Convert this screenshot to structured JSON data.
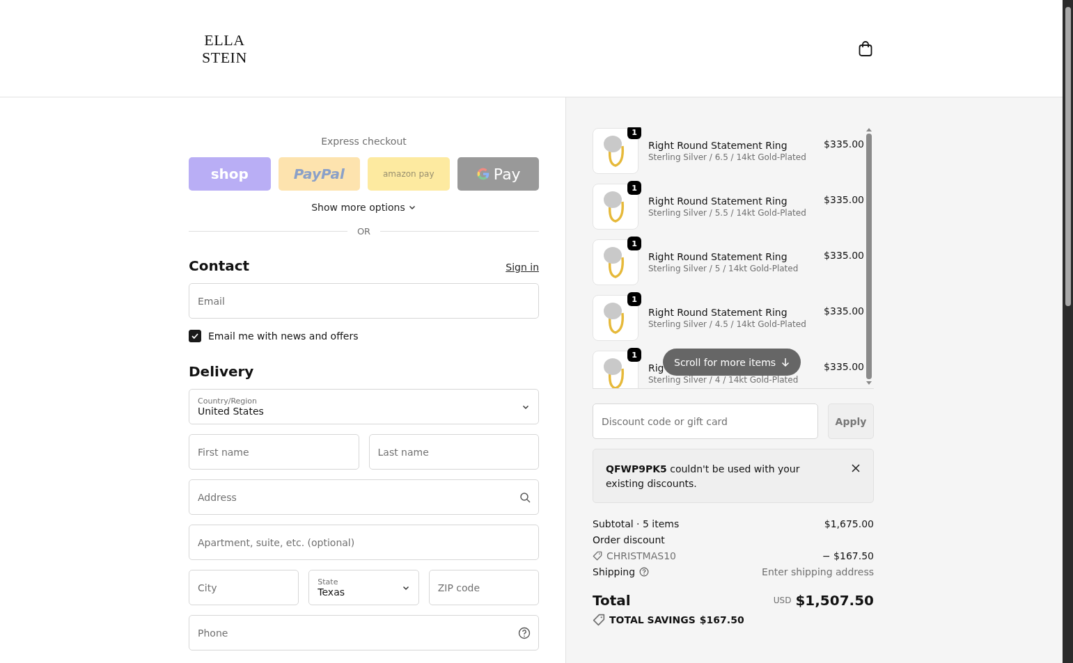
{
  "header": {
    "logo_lines": [
      "ELLA",
      "STEIN"
    ]
  },
  "express": {
    "title": "Express checkout",
    "buttons": [
      {
        "kind": "shop",
        "label": "shop"
      },
      {
        "kind": "paypal",
        "label": "PayPal"
      },
      {
        "kind": "amazon",
        "label": "amazon pay"
      },
      {
        "kind": "gpay",
        "label": "Pay"
      }
    ],
    "more": "Show more options",
    "divider": "OR"
  },
  "contact": {
    "title": "Contact",
    "sign_in": "Sign in",
    "email": {
      "placeholder": "Email"
    },
    "newsletter": {
      "label": "Email me with news and offers",
      "checked": true
    }
  },
  "delivery": {
    "title": "Delivery",
    "rows": [
      [
        {
          "kind": "select",
          "label": "Country/Region",
          "value": "United States"
        }
      ],
      [
        {
          "kind": "text",
          "placeholder": "First name"
        },
        {
          "kind": "text",
          "placeholder": "Last name"
        }
      ],
      [
        {
          "kind": "search",
          "placeholder": "Address"
        }
      ],
      [
        {
          "kind": "text",
          "placeholder": "Apartment, suite, etc. (optional)"
        }
      ],
      [
        {
          "kind": "text",
          "placeholder": "City"
        },
        {
          "kind": "select",
          "label": "State",
          "value": "Texas"
        },
        {
          "kind": "text",
          "placeholder": "ZIP code"
        }
      ],
      [
        {
          "kind": "help",
          "placeholder": "Phone"
        }
      ]
    ]
  },
  "order": {
    "items": [
      {
        "qty": "1",
        "name": "Right Round Statement Ring",
        "variant": "Sterling Silver / 6.5 / 14kt Gold-Plated",
        "price": "$335.00"
      },
      {
        "qty": "1",
        "name": "Right Round Statement Ring",
        "variant": "Sterling Silver / 5.5 / 14kt Gold-Plated",
        "price": "$335.00"
      },
      {
        "qty": "1",
        "name": "Right Round Statement Ring",
        "variant": "Sterling Silver / 5 / 14kt Gold-Plated",
        "price": "$335.00"
      },
      {
        "qty": "1",
        "name": "Right Round Statement Ring",
        "variant": "Sterling Silver / 4.5 / 14kt Gold-Plated",
        "price": "$335.00"
      },
      {
        "qty": "1",
        "name": "Rig",
        "variant": "Sterling Silver / 4 / 14kt Gold-Plated",
        "price": "$335.00"
      }
    ],
    "scroll_hint": "Scroll for more items",
    "discount": {
      "placeholder": "Discount code or gift card",
      "button": "Apply"
    },
    "notice": {
      "text": "**QFWP9PK5** couldn't be used with your existing discounts."
    },
    "summary": {
      "subtotal_label": "Subtotal · 5 items",
      "subtotal": "$1,675.00",
      "discount_label": "Order discount",
      "code": "CHRISTMAS10",
      "discount": "− $167.50",
      "shipping_label": "Shipping",
      "shipping": "Enter shipping address",
      "total_label": "Total",
      "currency": "USD",
      "total": "$1,507.50",
      "savings_label": "TOTAL SAVINGS",
      "savings": "$167.50"
    }
  }
}
